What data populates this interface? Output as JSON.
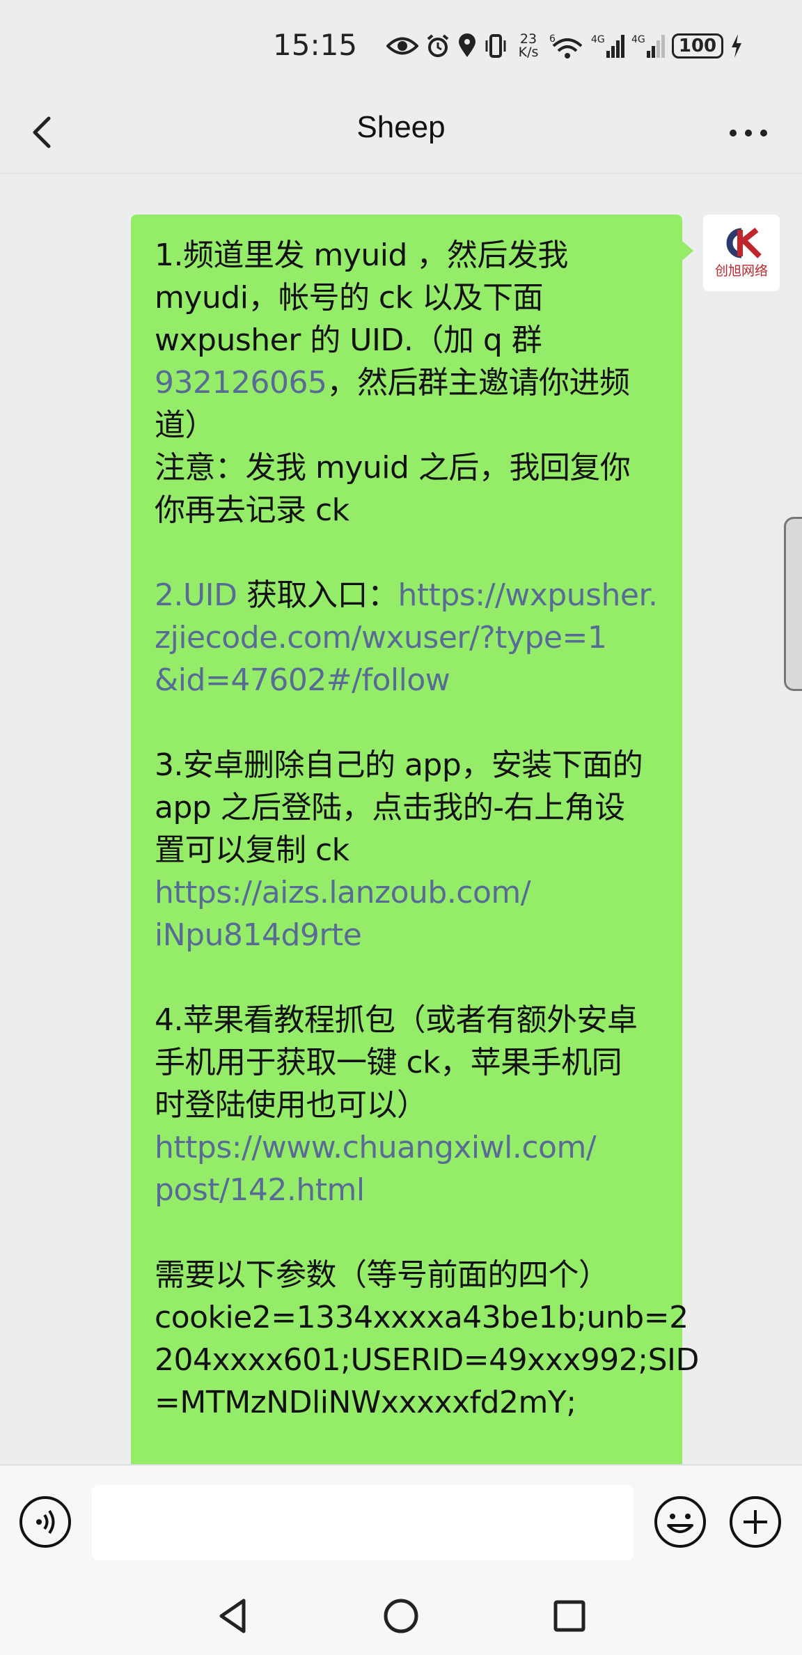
{
  "status_bar": {
    "time": "15:15",
    "net_speed_value": "23",
    "net_speed_unit": "K/s",
    "wifi_label": "6",
    "signal1_label": "4G",
    "signal2_label": "4G",
    "battery": "100",
    "icons": [
      "eye-icon",
      "alarm-icon",
      "location-icon",
      "vibrate-icon",
      "wifi-icon",
      "signal-icon",
      "signal-icon",
      "battery-icon",
      "charging-icon"
    ]
  },
  "header": {
    "title": "Sheep",
    "back_icon": "chevron-left-icon",
    "more_icon": "more-dots-icon"
  },
  "message": {
    "lines": [
      {
        "text": "1.频道里发 myuid ，然后发我",
        "link": false
      },
      {
        "text": "myudi，帐号的 ck 以及下面",
        "link": false
      },
      {
        "text": "wxpusher 的 UID.（加 q 群",
        "link": false
      },
      {
        "parts": [
          {
            "text": "932126065",
            "link": true
          },
          {
            "text": "，然后群主邀请你进频",
            "link": false
          }
        ]
      },
      {
        "text": "道）",
        "link": false
      },
      {
        "text": "注意：发我 myuid 之后，我回复你",
        "link": false
      },
      {
        "text": "你再去记录 ck",
        "link": false
      },
      {
        "text": "",
        "link": false
      },
      {
        "parts": [
          {
            "text": "2.UID",
            "link": true
          },
          {
            "text": " 获取入口：",
            "link": false
          },
          {
            "text": "https://wxpusher.",
            "link": true
          }
        ]
      },
      {
        "text": "zjiecode.com/wxuser/?type=1",
        "link": true
      },
      {
        "text": "&id=47602#/follow",
        "link": true
      },
      {
        "text": "",
        "link": false
      },
      {
        "text": "3.安卓删除自己的 app，安装下面的",
        "link": false
      },
      {
        "text": "app 之后登陆，点击我的-右上角设",
        "link": false
      },
      {
        "text": "置可以复制 ck",
        "link": false
      },
      {
        "text": "https://aizs.lanzoub.com/",
        "link": true
      },
      {
        "text": "iNpu814d9rte",
        "link": true
      },
      {
        "text": "",
        "link": false
      },
      {
        "text": "4.苹果看教程抓包（或者有额外安卓",
        "link": false
      },
      {
        "text": "手机用于获取一键 ck，苹果手机同",
        "link": false
      },
      {
        "text": "时登陆使用也可以）",
        "link": false
      },
      {
        "text": "https://www.chuangxiwl.com/",
        "link": true
      },
      {
        "text": "post/142.html",
        "link": true
      },
      {
        "text": "",
        "link": false
      },
      {
        "text": "需要以下参数（等号前面的四个）",
        "link": false
      },
      {
        "text": "cookie2=1334xxxxa43be1b;unb=2",
        "link": false
      },
      {
        "text": "204xxxx601;USERID=49xxx992;SID",
        "link": false
      },
      {
        "text": "=MTMzNDliNWxxxxxfd2mY;",
        "link": false
      }
    ]
  },
  "avatar": {
    "logo_text": "CK",
    "caption": "创旭网络"
  },
  "input_bar": {
    "voice_icon": "voice-icon",
    "emoji_icon": "emoji-icon",
    "plus_icon": "plus-circle-icon",
    "input_value": ""
  },
  "nav_bar": {
    "icons": [
      "nav-back-icon",
      "nav-home-icon",
      "nav-recent-icon"
    ]
  },
  "colors": {
    "bubble": "#95ec69",
    "link": "#576b95",
    "background": "#ededed"
  }
}
